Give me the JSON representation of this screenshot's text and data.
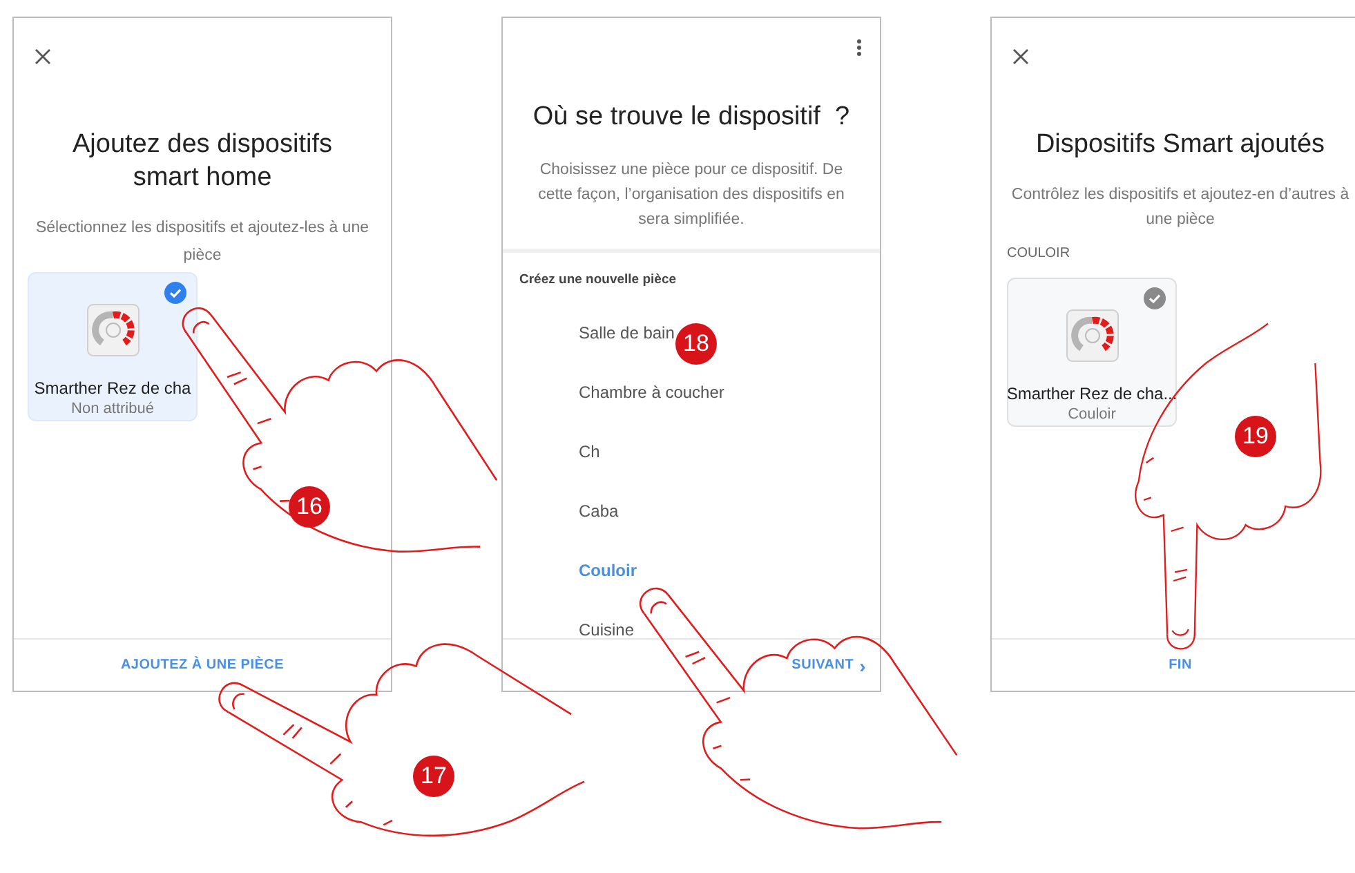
{
  "screen_1": {
    "title_lines": [
      "Ajoutez des dispositifs",
      "smart home"
    ],
    "description": "Sélectionnez les dispositifs et ajoutez-les à une pièce",
    "device": {
      "name": "Smarther Rez de cha",
      "room": "Non attribué",
      "selected": true
    },
    "action": "AJOUTEZ À UNE PIÈCE"
  },
  "screen_2": {
    "title": "Où se trouve le dispositif  ?",
    "description": "Choisissez une pièce pour ce dispositif. De cette façon, l’organisation des dispositifs en sera simplifiée.",
    "section": "Créez une nouvelle pièce",
    "rooms": [
      {
        "label": "Salle de bain",
        "selected": false
      },
      {
        "label": "Chambre à coucher",
        "selected": false
      },
      {
        "label": "Ch",
        "selected": false
      },
      {
        "label": "Caba",
        "selected": false
      },
      {
        "label": "Couloir",
        "selected": true
      },
      {
        "label": "Cuisine",
        "selected": false
      }
    ],
    "action": "SUIVANT",
    "action_icon": "›"
  },
  "screen_3": {
    "title": "Dispositifs Smart ajoutés",
    "description": "Contrôlez les dispositifs et ajoutez-en d’autres à une pièce",
    "group": "COULOIR",
    "device": {
      "name": "Smarther Rez de cha...",
      "room": "Couloir",
      "selected": false
    },
    "action": "FIN"
  },
  "steps": [
    "16",
    "17",
    "18",
    "19"
  ]
}
